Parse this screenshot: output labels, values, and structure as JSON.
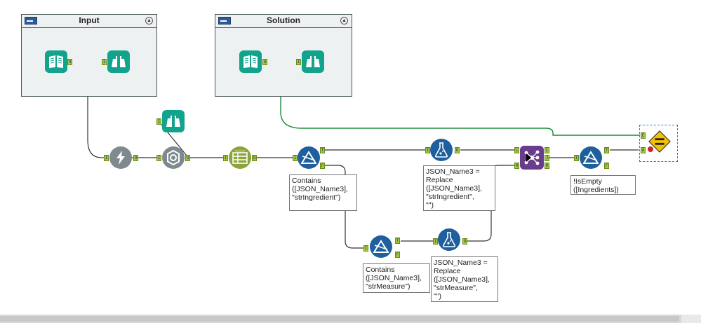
{
  "containers": {
    "input": {
      "title": "Input",
      "collapse_glyph": "▲"
    },
    "solution": {
      "title": "Solution",
      "collapse_glyph": "▲"
    }
  },
  "anchors": {
    "in": "I",
    "out": "O",
    "true": "T",
    "false": "F",
    "left": "L",
    "join": "J",
    "right": "R",
    "e": "E",
    "a": "A"
  },
  "annotations": {
    "filter_contains_ingredient": "Contains\n([JSON_Name3],\n\"strIngredient\")",
    "formula_replace_ingredient": "JSON_Name3 =\nReplace\n([JSON_Name3],\n\"strIngredient\",\n\"\")",
    "filter_isempty": "!IsEmpty\n([Ingredients])",
    "filter_contains_measure": "Contains\n([JSON_Name3],\n\"strMeasure\")",
    "formula_replace_measure": "JSON_Name3 =\nReplace\n([JSON_Name3],\n\"strMeasure\",\n\"\")"
  },
  "icons": {
    "input_data": "book-icon",
    "browse": "binoculars-icon",
    "dynamic_input": "lightning-icon",
    "json_parse": "gear-icon",
    "select": "select-icon",
    "filter": "filter-icon",
    "formula": "flask-icon",
    "join": "join-icon",
    "test": "equals-icon"
  },
  "colors": {
    "teal": "#12a38c",
    "blue": "#1e5f9e",
    "gray": "#7f8a8e",
    "olive": "#8ea33a",
    "purple": "#6a3d8c",
    "yellow": "#f2c200",
    "wire_green": "#1f8a3a"
  }
}
